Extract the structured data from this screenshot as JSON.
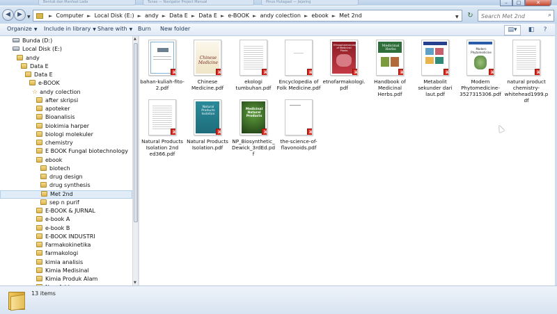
{
  "window": {
    "ghost_tabs": [
      "Bentuk dan Manfaat Lada",
      "Tunas — Navigator Project Manual",
      "Pinus Hutagaol — Jejaring"
    ],
    "controls": {
      "minimize": "–",
      "maximize": "□",
      "close": "✕"
    }
  },
  "nav": {
    "back_icon": "back-arrow-icon",
    "forward_icon": "forward-arrow-icon",
    "breadcrumbs": [
      "Computer",
      "Local Disk (E:)",
      "andy",
      "Data E",
      "Data E",
      "e-BOOK",
      "andy colection",
      "ebook",
      "Met 2nd"
    ],
    "search_placeholder": "Search Met 2nd"
  },
  "toolbar": {
    "organize": "Organize",
    "include": "Include in library",
    "share": "Share with",
    "burn": "Burn",
    "new_folder": "New folder"
  },
  "tree": [
    {
      "label": "Bunda (D:)",
      "type": "drive",
      "indent": 1
    },
    {
      "label": "Local Disk (E:)",
      "type": "drive",
      "indent": 1
    },
    {
      "label": "andy",
      "type": "folder",
      "indent": 2
    },
    {
      "label": "Data E",
      "type": "folder",
      "indent": 3
    },
    {
      "label": "Data E",
      "type": "folder",
      "indent": 4
    },
    {
      "label": "e-BOOK",
      "type": "folder",
      "indent": 5
    },
    {
      "label": "andy colection",
      "type": "star",
      "indent": 6
    },
    {
      "label": "after skripsi",
      "type": "folder",
      "indent": 7
    },
    {
      "label": "apoteker",
      "type": "folder",
      "indent": 7
    },
    {
      "label": "Bioanalisis",
      "type": "folder",
      "indent": 7
    },
    {
      "label": "biokimia harper",
      "type": "folder",
      "indent": 7
    },
    {
      "label": "biologi molekuler",
      "type": "folder",
      "indent": 7
    },
    {
      "label": "chemistry",
      "type": "folder",
      "indent": 7
    },
    {
      "label": "E BOOK Fungal biotechnology",
      "type": "folder",
      "indent": 7
    },
    {
      "label": "ebook",
      "type": "folder",
      "indent": 7
    },
    {
      "label": "biotech",
      "type": "folder",
      "indent": 8
    },
    {
      "label": "drug design",
      "type": "folder",
      "indent": 8
    },
    {
      "label": "drug synthesis",
      "type": "folder",
      "indent": 8
    },
    {
      "label": "Met 2nd",
      "type": "folder",
      "indent": 8,
      "selected": true
    },
    {
      "label": "sep n purif",
      "type": "folder",
      "indent": 8
    },
    {
      "label": "E-BOOK & JURNAL",
      "type": "folder",
      "indent": 7
    },
    {
      "label": "e-book A",
      "type": "folder",
      "indent": 7
    },
    {
      "label": "e-book B",
      "type": "folder",
      "indent": 7
    },
    {
      "label": "E-BOOK INDUSTRI",
      "type": "folder",
      "indent": 7
    },
    {
      "label": "Farmakokinetika",
      "type": "folder",
      "indent": 7
    },
    {
      "label": "farmakologi",
      "type": "folder",
      "indent": 7
    },
    {
      "label": "kimia analisis",
      "type": "folder",
      "indent": 7
    },
    {
      "label": "Kimia Medisinal",
      "type": "folder",
      "indent": 7
    },
    {
      "label": "Kimia Produk Alam",
      "type": "folder",
      "indent": 7
    },
    {
      "label": "New folder",
      "type": "folder",
      "indent": 7
    }
  ],
  "files": [
    {
      "name": "bahan-kuliah-fito-2.pdf",
      "cover": "plain-blue-border"
    },
    {
      "name": "Chinese Medicine.pdf",
      "cover": "chinese"
    },
    {
      "name": "ekologi tumbuhan.pdf",
      "cover": "text"
    },
    {
      "name": "Encyclopedia of Folk Medicine.pdf",
      "cover": "blank"
    },
    {
      "name": "etnofarmakologi.pdf",
      "cover": "red"
    },
    {
      "name": "Handbook of Medicinal Herbs.pdf",
      "cover": "herbs"
    },
    {
      "name": "Metabolit sekunder dari laut.pdf",
      "cover": "blue-sea"
    },
    {
      "name": "Modern Phytomedicine-3527315306.pdf",
      "cover": "phyto"
    },
    {
      "name": "natural product chemistry-whitehead1999.pdf",
      "cover": "text"
    },
    {
      "name": "Natural Products Isolation 2nd ed366.pdf",
      "cover": "text"
    },
    {
      "name": "Natural Products Isolation.pdf",
      "cover": "teal"
    },
    {
      "name": "NP_Biosynthetic_Dewick_3rdEd.pdf",
      "cover": "green"
    },
    {
      "name": "the-science-of-flavonoids.pdf",
      "cover": "blank-title"
    }
  ],
  "covers": {
    "chinese_title": "Chinese Medicine",
    "herbs_title": "Medicinal Herbs",
    "phyto_title": "Modern Phytomedicine",
    "npi_title": "Natural Products Isolation",
    "np_title": "Medicinal Natural Products",
    "etno_title": "Ethnopharmacology of Medicinal Plants"
  },
  "pdf_icon": "pdf-file-icon",
  "status": {
    "count": "13 items"
  }
}
